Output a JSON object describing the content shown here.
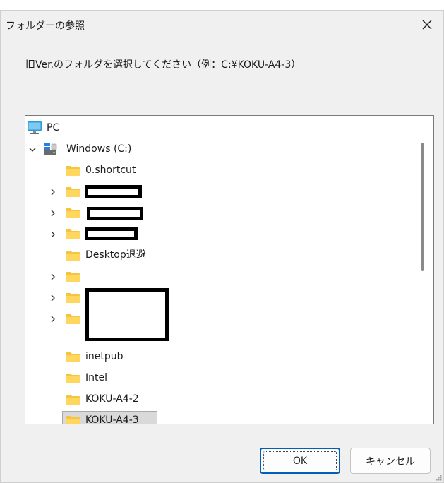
{
  "dialog": {
    "title": "フォルダーの参照",
    "instruction": "旧Ver.のフォルダを選択してください（例：C:¥KOKU-A4-3）"
  },
  "tree": {
    "root_label": "PC",
    "drive_label": "Windows (C:)",
    "items": [
      {
        "label": "0.shortcut",
        "expandable": false,
        "redacted": false
      },
      {
        "label": "",
        "expandable": true,
        "redacted": true
      },
      {
        "label": "",
        "expandable": true,
        "redacted": true
      },
      {
        "label": "",
        "expandable": true,
        "redacted": true
      },
      {
        "label": "Desktop退避",
        "expandable": false,
        "redacted": false
      },
      {
        "label": "",
        "expandable": true,
        "redacted": true
      },
      {
        "label": "",
        "expandable": true,
        "redacted": true
      },
      {
        "label": "",
        "expandable": true,
        "redacted": true
      },
      {
        "label": "inetpub",
        "expandable": false,
        "redacted": false
      },
      {
        "label": "Intel",
        "expandable": false,
        "redacted": false
      },
      {
        "label": "KOKU-A4-2",
        "expandable": false,
        "redacted": false
      },
      {
        "label": "KOKU-A4-3",
        "expandable": false,
        "redacted": false,
        "selected": true
      }
    ]
  },
  "buttons": {
    "ok_label": "OK",
    "cancel_label": "キャンセル"
  },
  "icons": {
    "close": "close-icon",
    "pc": "computer-icon",
    "drive": "drive-icon",
    "folder": "folder-icon",
    "expand": "chevron-right-icon",
    "collapse": "chevron-down-icon"
  },
  "colors": {
    "folder": "#f5c542",
    "selection": "#d9d9d9",
    "ok_border": "#005fb8",
    "annotation": "#ff1a1a"
  }
}
